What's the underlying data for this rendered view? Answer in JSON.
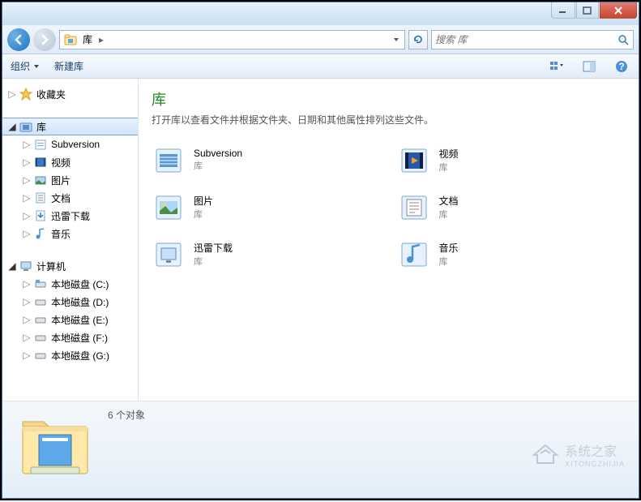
{
  "titlebar": {},
  "nav": {
    "breadcrumb": "库",
    "search_placeholder": "搜索 库"
  },
  "toolbar": {
    "organize": "组织",
    "new_library": "新建库"
  },
  "sidebar": {
    "favorites": "收藏夹",
    "libraries": "库",
    "lib_items": [
      {
        "label": "Subversion"
      },
      {
        "label": "视频"
      },
      {
        "label": "图片"
      },
      {
        "label": "文档"
      },
      {
        "label": "迅雷下载"
      },
      {
        "label": "音乐"
      }
    ],
    "computer": "计算机",
    "drives": [
      {
        "label": "本地磁盘 (C:)"
      },
      {
        "label": "本地磁盘 (D:)"
      },
      {
        "label": "本地磁盘 (E:)"
      },
      {
        "label": "本地磁盘 (F:)"
      },
      {
        "label": "本地磁盘 (G:)"
      }
    ]
  },
  "content": {
    "title": "库",
    "description": "打开库以查看文件并根据文件夹、日期和其他属性排列这些文件。",
    "sub": "库",
    "items": [
      {
        "name": "Subversion"
      },
      {
        "name": "视频"
      },
      {
        "name": "图片"
      },
      {
        "name": "文档"
      },
      {
        "name": "迅雷下载"
      },
      {
        "name": "音乐"
      }
    ]
  },
  "status": {
    "text": "6 个对象"
  },
  "watermark": {
    "title": "系统之家",
    "sub": "XITONGZHIJIA"
  }
}
